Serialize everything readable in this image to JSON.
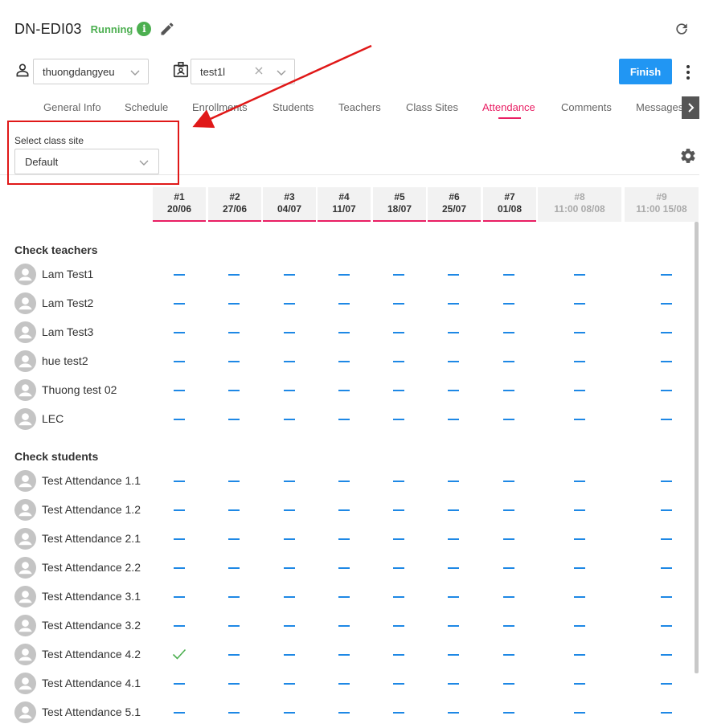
{
  "header": {
    "title": "DN-EDI03",
    "status": "Running",
    "info_glyph": "i",
    "status_color": "#4caf50"
  },
  "icons": {
    "edit": "pencil-icon",
    "refresh": "refresh-icon",
    "person": "person-icon",
    "badge": "id-badge-icon",
    "more": "more-vertical-icon",
    "gear": "gear-icon",
    "avatar": "avatar-icon"
  },
  "filters": {
    "user_value": "thuongdangyeu",
    "class_value": "test1l"
  },
  "actions": {
    "finish_label": "Finish",
    "accent_color": "#2196f3"
  },
  "tabs": [
    {
      "label": "General Info"
    },
    {
      "label": "Schedule"
    },
    {
      "label": "Enrollments"
    },
    {
      "label": "Students"
    },
    {
      "label": "Teachers"
    },
    {
      "label": "Class Sites"
    },
    {
      "label": "Attendance",
      "active": true
    },
    {
      "label": "Comments"
    },
    {
      "label": "Messages"
    }
  ],
  "tab_active_color": "#e91e63",
  "class_site": {
    "label": "Select class site",
    "value": "Default"
  },
  "sessions": [
    {
      "num": "#1",
      "date": "20/06",
      "past": true
    },
    {
      "num": "#2",
      "date": "27/06",
      "past": true
    },
    {
      "num": "#3",
      "date": "04/07",
      "past": true
    },
    {
      "num": "#4",
      "date": "11/07",
      "past": true
    },
    {
      "num": "#5",
      "date": "18/07",
      "past": true
    },
    {
      "num": "#6",
      "date": "25/07",
      "past": true
    },
    {
      "num": "#7",
      "date": "01/08",
      "past": true
    },
    {
      "num": "#8",
      "date": "11:00 08/08",
      "past": false
    },
    {
      "num": "#9",
      "date": "11:00 15/08",
      "past": false
    }
  ],
  "sections": {
    "teachers_title": "Check teachers",
    "students_title": "Check students"
  },
  "teachers": [
    {
      "name": "Lam Test1",
      "marks": [
        "none",
        "none",
        "none",
        "none",
        "none",
        "none",
        "none",
        "none",
        "none"
      ]
    },
    {
      "name": "Lam Test2",
      "marks": [
        "none",
        "none",
        "none",
        "none",
        "none",
        "none",
        "none",
        "none",
        "none"
      ]
    },
    {
      "name": "Lam Test3",
      "marks": [
        "none",
        "none",
        "none",
        "none",
        "none",
        "none",
        "none",
        "none",
        "none"
      ]
    },
    {
      "name": "hue test2",
      "marks": [
        "none",
        "none",
        "none",
        "none",
        "none",
        "none",
        "none",
        "none",
        "none"
      ]
    },
    {
      "name": "Thuong test 02",
      "marks": [
        "none",
        "none",
        "none",
        "none",
        "none",
        "none",
        "none",
        "none",
        "none"
      ]
    },
    {
      "name": "LEC",
      "marks": [
        "none",
        "none",
        "none",
        "none",
        "none",
        "none",
        "none",
        "none",
        "none"
      ]
    }
  ],
  "students": [
    {
      "name": "Test Attendance 1.1",
      "marks": [
        "none",
        "none",
        "none",
        "none",
        "none",
        "none",
        "none",
        "none",
        "none"
      ]
    },
    {
      "name": "Test Attendance 1.2",
      "marks": [
        "none",
        "none",
        "none",
        "none",
        "none",
        "none",
        "none",
        "none",
        "none"
      ]
    },
    {
      "name": "Test Attendance 2.1",
      "marks": [
        "none",
        "none",
        "none",
        "none",
        "none",
        "none",
        "none",
        "none",
        "none"
      ]
    },
    {
      "name": "Test Attendance 2.2",
      "marks": [
        "none",
        "none",
        "none",
        "none",
        "none",
        "none",
        "none",
        "none",
        "none"
      ]
    },
    {
      "name": "Test Attendance 3.1",
      "marks": [
        "none",
        "none",
        "none",
        "none",
        "none",
        "none",
        "none",
        "none",
        "none"
      ]
    },
    {
      "name": "Test Attendance 3.2",
      "marks": [
        "none",
        "none",
        "none",
        "none",
        "none",
        "none",
        "none",
        "none",
        "none"
      ]
    },
    {
      "name": "Test Attendance 4.2",
      "marks": [
        "present",
        "none",
        "none",
        "none",
        "none",
        "none",
        "none",
        "none",
        "none"
      ]
    },
    {
      "name": "Test Attendance 4.1",
      "marks": [
        "none",
        "none",
        "none",
        "none",
        "none",
        "none",
        "none",
        "none",
        "none"
      ]
    },
    {
      "name": "Test Attendance 5.1",
      "marks": [
        "none",
        "none",
        "none",
        "none",
        "none",
        "none",
        "none",
        "none",
        "none"
      ]
    }
  ],
  "mark_colors": {
    "none": "#1e88e5",
    "present": "#4caf50"
  },
  "annotation_color": "#e01818"
}
